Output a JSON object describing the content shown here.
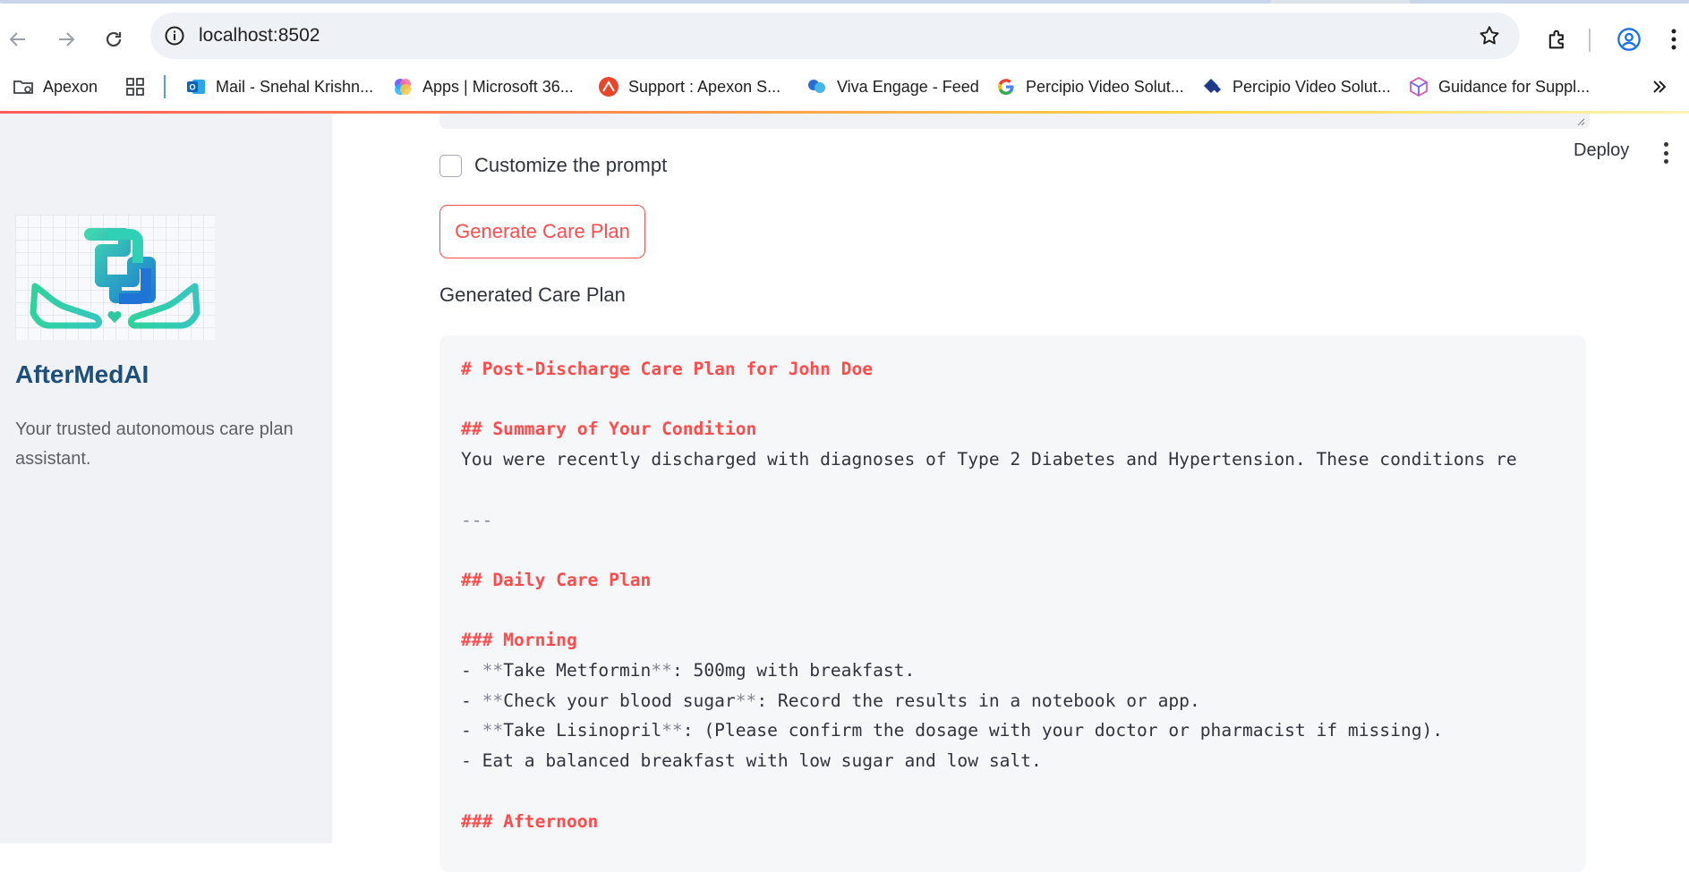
{
  "browser": {
    "url": "localhost:8502",
    "bookmarks": [
      {
        "label": "Apexon",
        "icon": "folder-gear-icon"
      },
      {
        "label": "",
        "icon": "apps-grid-icon"
      },
      {
        "label": "Mail - Snehal Krishn...",
        "icon": "outlook-icon"
      },
      {
        "label": "Apps | Microsoft 36...",
        "icon": "microsoft365-icon"
      },
      {
        "label": "Support : Apexon S...",
        "icon": "support-icon"
      },
      {
        "label": "Viva Engage - Feed",
        "icon": "viva-engage-icon"
      },
      {
        "label": "Percipio Video Solut...",
        "icon": "google-icon"
      },
      {
        "label": "Percipio Video Solut...",
        "icon": "percipio-icon"
      },
      {
        "label": "Guidance for Suppl...",
        "icon": "cube-icon"
      }
    ]
  },
  "sidebar": {
    "app_name": "AfterMedAI",
    "description": "Your trusted autonomous care plan assistant."
  },
  "header": {
    "deploy_label": "Deploy"
  },
  "main": {
    "checkbox_label": "Customize the prompt",
    "checkbox_checked": false,
    "generate_button": "Generate Care Plan",
    "section_label": "Generated Care Plan",
    "code_lines": [
      {
        "text": "# Post-Discharge Care Plan for John Doe",
        "kind": "heading"
      },
      {
        "text": "",
        "kind": "blank"
      },
      {
        "text": "## Summary of Your Condition",
        "kind": "heading"
      },
      {
        "text": "You were recently discharged with diagnoses of Type 2 Diabetes and Hypertension. These conditions re",
        "kind": "text"
      },
      {
        "text": "",
        "kind": "blank"
      },
      {
        "text": "---",
        "kind": "rule"
      },
      {
        "text": "",
        "kind": "blank"
      },
      {
        "text": "## Daily Care Plan",
        "kind": "heading"
      },
      {
        "text": "",
        "kind": "blank"
      },
      {
        "text": "### Morning",
        "kind": "heading"
      },
      {
        "text": "- **Take Metformin**: 500mg with breakfast.",
        "kind": "text"
      },
      {
        "text": "- **Check your blood sugar**: Record the results in a notebook or app.",
        "kind": "text"
      },
      {
        "text": "- **Take Lisinopril**: (Please confirm the dosage with your doctor or pharmacist if missing).",
        "kind": "text"
      },
      {
        "text": "- Eat a balanced breakfast with low sugar and low salt.",
        "kind": "text"
      },
      {
        "text": "",
        "kind": "blank"
      },
      {
        "text": "### Afternoon",
        "kind": "heading"
      }
    ]
  },
  "colors": {
    "accent": "#ff4b4b",
    "sidebar_bg": "#f0f2f6",
    "app_name": "#1c4f7a",
    "code_bg": "#f6f7f9"
  }
}
